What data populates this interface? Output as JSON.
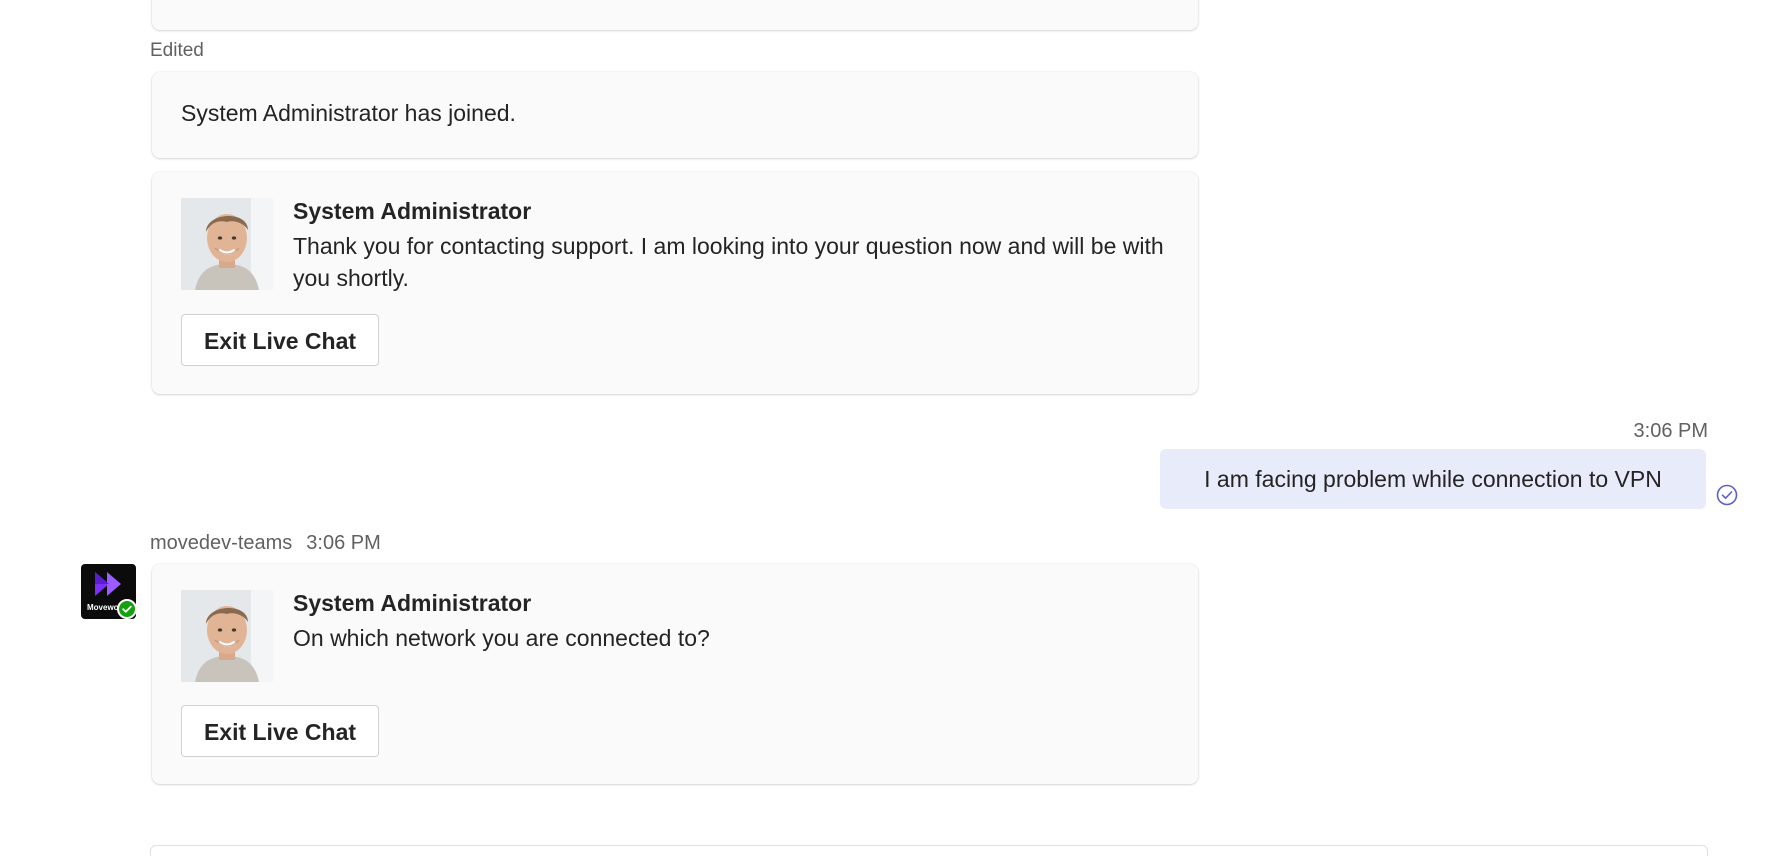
{
  "chat": {
    "edited_label": "Edited",
    "joined_message": "System Administrator has joined.",
    "messages": [
      {
        "sender": "System Administrator",
        "text": "Thank you for contacting support. I am looking into your question now and will be with you shortly.",
        "button_label": "Exit Live Chat"
      },
      {
        "sender": "System Administrator",
        "text": "On which network you are connected to?",
        "button_label": "Exit Live Chat"
      }
    ],
    "outgoing": {
      "time": "3:06 PM",
      "text": "I am facing problem while connection to VPN",
      "status_icon": "read-check-icon"
    },
    "bot_meta": {
      "name": "movedev-teams",
      "time": "3:06 PM",
      "avatar_text": "Movewo",
      "presence": "available"
    }
  },
  "colors": {
    "card_bg": "#fafafa",
    "outgoing_bubble": "#e8ebfa",
    "presence_green": "#13a10e",
    "brand_purple": "#7b2ff7",
    "read_icon": "#5b5fc7"
  }
}
